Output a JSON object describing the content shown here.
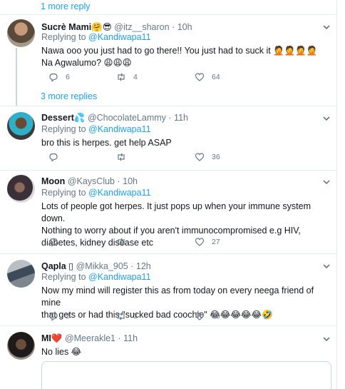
{
  "top_more": "1 more reply",
  "mid_more": "3 more replies",
  "colors": {
    "link": "#1da1f2",
    "muted": "#657786",
    "text": "#14171a",
    "divider": "#e6ecf0"
  },
  "tweets": [
    {
      "name": "Sucrè Mami",
      "name_emoji": "🤗😎",
      "handle": "@itz__sharon",
      "time": "10h",
      "replying_prefix": "Replying to ",
      "replying_to": "@Kandiwapa11",
      "text_lines": [
        "Nawa ooo you just had to go there!! You just had to suck it 🤦🤦🤦🤦",
        "Na Agwalumo? 😩😩😩"
      ],
      "replies": "6",
      "retweets": "4",
      "likes": "64"
    },
    {
      "name": "Dessert",
      "name_emoji": "💦",
      "handle": "@ChocolateLammy",
      "time": "11h",
      "replying_prefix": "Replying to ",
      "replying_to": "@Kandiwapa11",
      "text_lines": [
        "bro this is herpes. get help ASAP"
      ],
      "replies": "",
      "retweets": "",
      "likes": "36"
    },
    {
      "name": "Moon",
      "name_emoji": "",
      "handle": "@KaysClub",
      "time": "10h",
      "replying_prefix": "Replying to ",
      "replying_to": "@Kandiwapa11",
      "text_lines": [
        "Lots of people got herpes. It just pops up when your immune system down.",
        "Nothing to worry about if you aren't immunocompromised e.g HIV,",
        "diabetes, kidney disease etc"
      ],
      "replies": "",
      "retweets": "",
      "likes": "27"
    },
    {
      "name": "Qapla",
      "name_emoji": "▯",
      "handle": "@Mikka_905",
      "time": "12h",
      "replying_prefix": "Replying to ",
      "replying_to": "@Kandiwapa11",
      "text_lines": [
        "Now my mind will register this as from today on every neega friend of mine",
        "that gets or had this \"sucked bad coochie\" 😂😂😂😂😂🤣"
      ],
      "replies": "2",
      "retweets": "3",
      "likes": "85"
    },
    {
      "name": "MI",
      "name_emoji": "❤️",
      "handle": "@Meerakle1",
      "time": "11h",
      "replying_prefix": "",
      "replying_to": "",
      "text_lines": [
        "No lies 😂"
      ],
      "replies": "",
      "retweets": "",
      "likes": ""
    }
  ]
}
